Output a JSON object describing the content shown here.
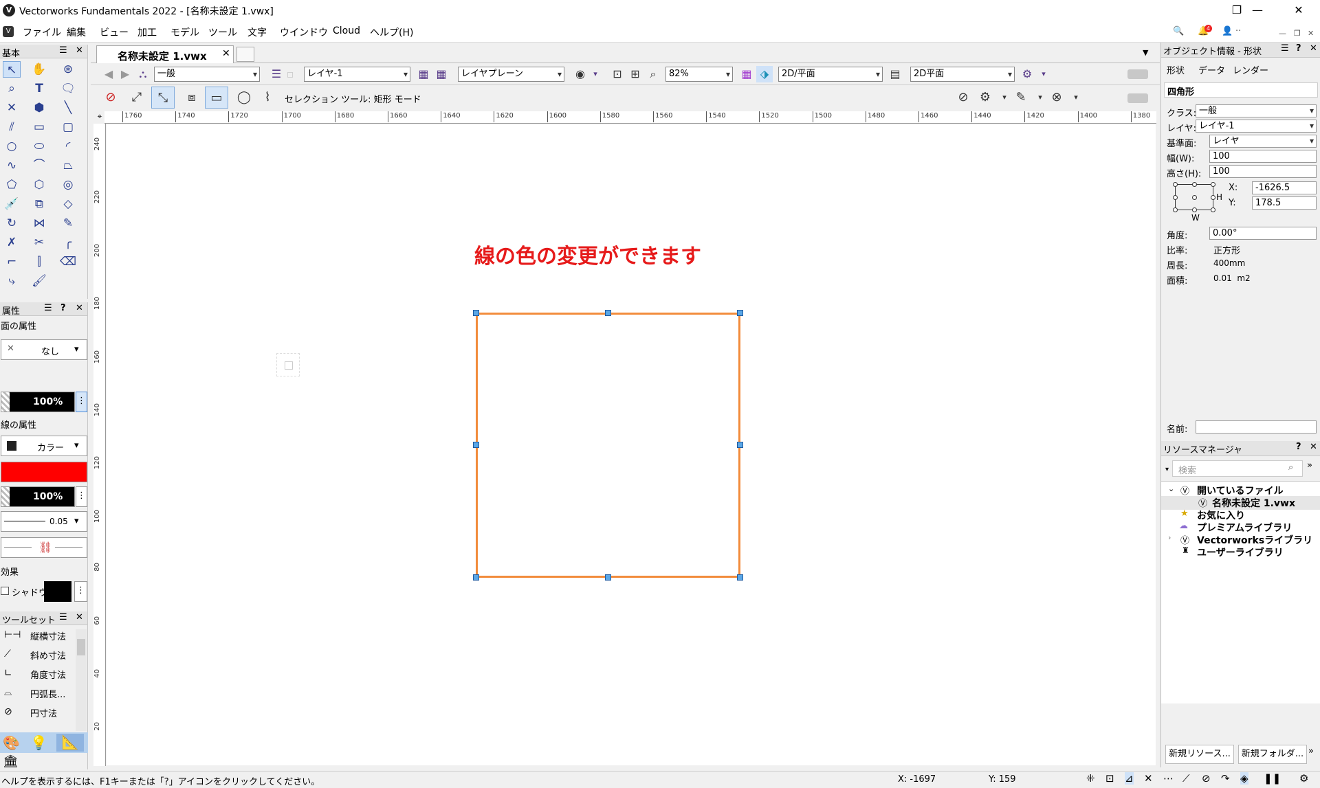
{
  "window": {
    "title": "Vectorworks Fundamentals 2022 - [名称未設定 1.vwx]",
    "controls": {
      "minimize": "—",
      "restore": "❐",
      "close": "✕"
    }
  },
  "menu": {
    "items": [
      "ファイル",
      "編集",
      "ビュー",
      "加工",
      "モデル",
      "ツール",
      "文字",
      "ウインドウ",
      "Cloud",
      "ヘルプ(H)"
    ],
    "badge": "4"
  },
  "basic_palette": {
    "title": "基本",
    "ctl_menu": "☰",
    "ctl_close": "✕"
  },
  "attributes": {
    "title": "属性",
    "ctl_menu": "☰",
    "ctl_help": "?",
    "ctl_close": "✕",
    "fill_label": "面の属性",
    "fill_value": "なし",
    "fill_opacity": "100%",
    "line_label": "線の属性",
    "line_type": "カラー",
    "line_color": "#ff0000",
    "line_opacity": "100%",
    "line_weight": "0.05",
    "effects_label": "効果",
    "shadow_label": "シャドウ"
  },
  "toolset": {
    "title": "ツールセット",
    "items": [
      "縦横寸法",
      "斜め寸法",
      "角度寸法",
      "円弧長...",
      "円寸法"
    ]
  },
  "document": {
    "tab_label": "名称未設定 1.vwx",
    "tab_close": "✕"
  },
  "viewbar": {
    "class": "一般",
    "layer": "レイヤ-1",
    "plane": "レイヤプレーン",
    "zoom": "82%",
    "view": "2D/平面",
    "render": "2D平面"
  },
  "modebar": {
    "status": "セレクション ツール: 矩形 モード"
  },
  "ruler": {
    "h_labels": [
      "1760",
      "1740",
      "1720",
      "1700",
      "1680",
      "1660",
      "1640",
      "1620",
      "1600",
      "1580",
      "1560",
      "1540",
      "1520",
      "1500",
      "1480",
      "1460",
      "1440",
      "1420",
      "1400",
      "1380"
    ],
    "v_labels": [
      "240",
      "220",
      "200",
      "180",
      "160",
      "140",
      "120",
      "100",
      "80",
      "60",
      "40",
      "20"
    ]
  },
  "canvas": {
    "annotation": "線の色の変更ができます",
    "shape_stroke": "#f28c3c"
  },
  "oip": {
    "title": "オブジェクト情報 - 形状",
    "ctl_menu": "☰",
    "ctl_help": "?",
    "ctl_close": "✕",
    "tabs": [
      "形状",
      "データ",
      "レンダー"
    ],
    "shape_name": "四角形",
    "class_label": "クラス:",
    "class_value": "一般",
    "layer_label": "レイヤ:",
    "layer_value": "レイヤ-1",
    "plane_label": "基準面:",
    "plane_value": "レイヤ",
    "width_label": "幅(W):",
    "width_value": "100",
    "height_label": "高さ(H):",
    "height_value": "100",
    "x_label": "X:",
    "x_value": "-1626.5",
    "y_label": "Y:",
    "y_value": "178.5",
    "h_mark": "H",
    "w_mark": "W",
    "angle_label": "角度:",
    "angle_value": "0.00°",
    "ratio_label": "比率:",
    "ratio_value": "正方形",
    "perimeter_label": "周長:",
    "perimeter_value": "400mm",
    "area_label": "面積:",
    "area_value": "0.01  m2",
    "name_label": "名前:"
  },
  "resource_manager": {
    "title": "リソースマネージャ",
    "ctl_help": "?",
    "ctl_close": "✕",
    "search_placeholder": "検索",
    "tree": [
      {
        "label": "開いているファイル"
      },
      {
        "label": "名称未設定 1.vwx"
      },
      {
        "label": "お気に入り"
      },
      {
        "label": "プレミアムライブラリ"
      },
      {
        "label": "Vectorworksライブラリ"
      },
      {
        "label": "ユーザーライブラリ"
      }
    ],
    "btn_new_resource": "新規リソース...",
    "btn_new_folder": "新規フォルダ..."
  },
  "status": {
    "help": "ヘルプを表示するには、F1キーまたは「?」アイコンをクリックしてください。",
    "x": "X: -1697",
    "y": "Y: 159"
  }
}
